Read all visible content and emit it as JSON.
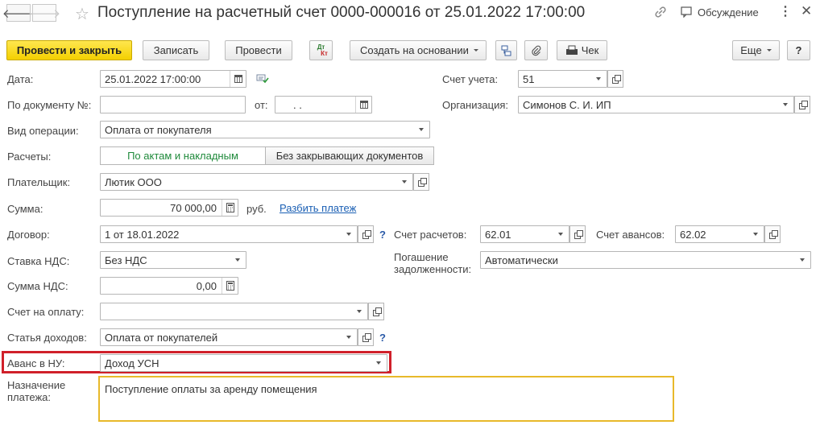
{
  "header": {
    "title": "Поступление на расчетный счет 0000-000016 от 25.01.2022 17:00:00",
    "discussion_label": "Обсуждение"
  },
  "toolbar": {
    "post_and_close": "Провести и закрыть",
    "save": "Записать",
    "post": "Провести",
    "dt_kt_top": "Дт",
    "dt_kt_bottom": "Кт",
    "create_based_on": "Создать на основании",
    "receipt": "Чек",
    "more": "Еще",
    "help": "?"
  },
  "form": {
    "date": {
      "label": "Дата:",
      "value": "25.01.2022 17:00:00"
    },
    "doc_number": {
      "label": "По документу №:",
      "value": "",
      "from_label": "от:",
      "from_value": " .  ."
    },
    "operation_type": {
      "label": "Вид операции:",
      "value": "Оплата от покупателя"
    },
    "settlements": {
      "label": "Расчеты:",
      "options": [
        "По актам и накладным",
        "Без закрывающих документов"
      ],
      "selected": 0
    },
    "payer": {
      "label": "Плательщик:",
      "value": "Лютик ООО"
    },
    "amount": {
      "label": "Сумма:",
      "value": "70 000,00",
      "currency": "руб.",
      "split_link": "Разбить платеж"
    },
    "contract": {
      "label": "Договор:",
      "value": "1 от 18.01.2022",
      "help": "?"
    },
    "vat_rate": {
      "label": "Ставка НДС:",
      "value": "Без НДС"
    },
    "vat_amount": {
      "label": "Сумма НДС:",
      "value": "0,00"
    },
    "invoice": {
      "label": "Счет на оплату:",
      "value": ""
    },
    "income_item": {
      "label": "Статья доходов:",
      "value": "Оплата от покупателей",
      "help": "?"
    },
    "advance_tax": {
      "label": "Аванс в НУ:",
      "value": "Доход УСН"
    },
    "purpose": {
      "label_line1": "Назначение",
      "label_line2": "платежа:",
      "value": "Поступление оплаты за аренду помещения"
    },
    "account": {
      "label": "Счет учета:",
      "value": "51"
    },
    "organization": {
      "label": "Организация:",
      "value": "Симонов С. И. ИП"
    },
    "settlement_account": {
      "label": "Счет расчетов:",
      "value": "62.01"
    },
    "advance_account": {
      "label": "Счет авансов:",
      "value": "62.02"
    },
    "debt_repayment": {
      "label_line1": "Погашение",
      "label_line2": "задолженности:",
      "value": "Автоматически"
    }
  },
  "colors": {
    "primary_button": "#f3d000",
    "highlight_red": "#d0202a",
    "highlight_yellow": "#e8b92a",
    "link": "#1a5fb4",
    "selected_segment_text": "#1f8a3b"
  }
}
